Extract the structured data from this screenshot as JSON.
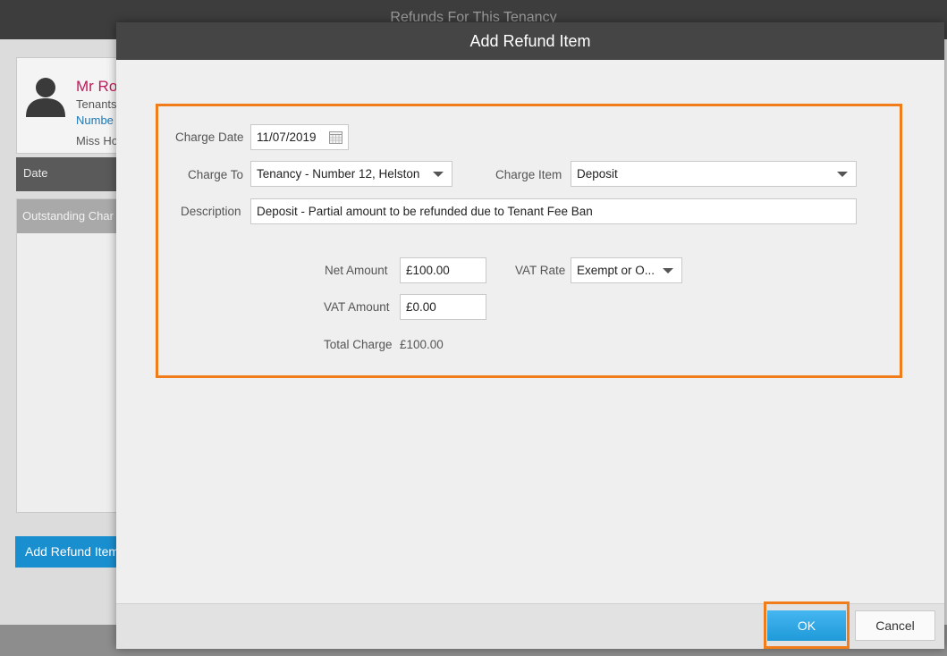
{
  "background_window": {
    "title": "Refunds For This Tenancy",
    "contact": {
      "name": "Mr Ro",
      "role": "Tenants",
      "address": "Numbe",
      "other": "Miss Ho"
    },
    "columns": {
      "date": "Date"
    },
    "list_header": "Outstanding Char",
    "add_refund_button": "Add Refund Item"
  },
  "modal": {
    "title": "Add Refund Item",
    "charge_date": {
      "label": "Charge Date",
      "value": "11/07/2019"
    },
    "charge_to": {
      "label": "Charge To",
      "value": "Tenancy - Number 12, Helston"
    },
    "charge_item": {
      "label": "Charge Item",
      "value": "Deposit"
    },
    "description": {
      "label": "Description",
      "value": "Deposit - Partial amount to be refunded due to Tenant Fee Ban"
    },
    "net_amount": {
      "label": "Net Amount",
      "value": "£100.00"
    },
    "vat_rate": {
      "label": "VAT Rate",
      "value": "Exempt or O..."
    },
    "vat_amount": {
      "label": "VAT Amount",
      "value": "£0.00"
    },
    "total_charge": {
      "label": "Total Charge",
      "value": "£100.00"
    },
    "buttons": {
      "ok": "OK",
      "cancel": "Cancel"
    }
  },
  "colors": {
    "accent": "#f07c1a",
    "primary_button": "#2aa6e6",
    "header": "#454545",
    "contact_name": "#c2185b"
  }
}
